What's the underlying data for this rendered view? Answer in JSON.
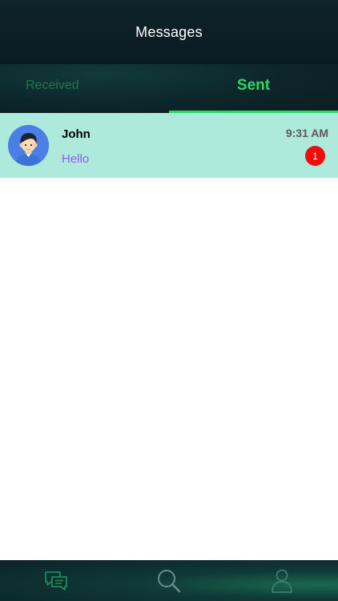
{
  "header": {
    "title": "Messages"
  },
  "tabs": [
    {
      "label": "Received",
      "active": false
    },
    {
      "label": "Sent",
      "active": true
    }
  ],
  "messages": [
    {
      "name": "John",
      "preview": "Hello",
      "time": "9:31 AM",
      "unread": "1"
    }
  ],
  "bottom_nav": {
    "items": [
      {
        "icon": "chat-icon"
      },
      {
        "icon": "search-icon"
      },
      {
        "icon": "profile-icon"
      }
    ]
  },
  "colors": {
    "accent": "#2bd96b",
    "row_highlight": "#aeeadb",
    "badge": "#f20d0d",
    "preview_text": "#8a5cf0",
    "avatar_bg": "#4a7fe8"
  }
}
